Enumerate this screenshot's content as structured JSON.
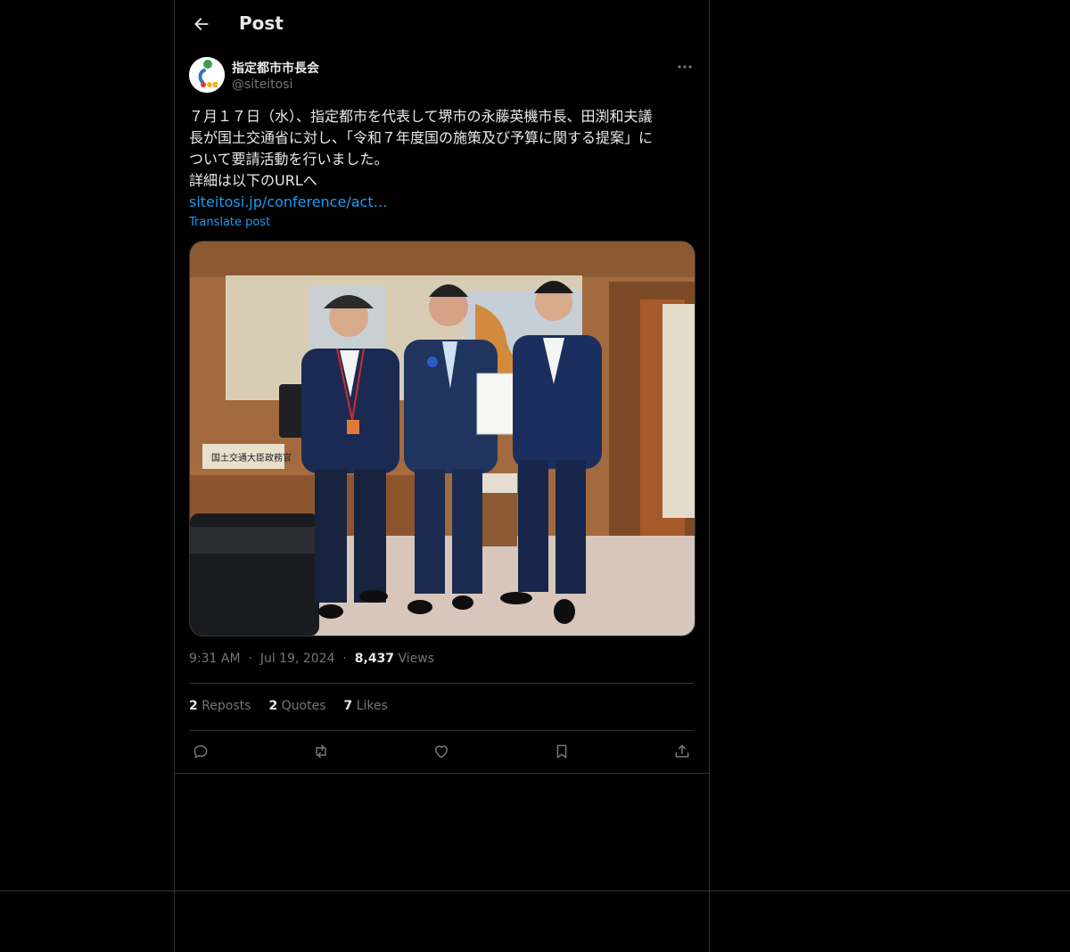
{
  "header": {
    "title": "Post",
    "back_icon": "arrow-left-icon"
  },
  "author": {
    "name": "指定都市市長会",
    "handle": "@siteitosi"
  },
  "post": {
    "lines": [
      "７月１７日（水）、指定都市を代表して堺市の永藤英機市長、田渕和夫議",
      "長が国土交通省に対し、「令和７年度国の施策及び予算に関する提案」に",
      "ついて要請活動を行いました。",
      "詳細は以下のURLへ"
    ],
    "link_text": "siteitosi.jp/conference/act…",
    "translate_label": "Translate post",
    "media_sign_text": "国土交通大臣政務官"
  },
  "meta": {
    "time": "9:31 AM",
    "date": "Jul 19, 2024",
    "views_count": "8,437",
    "views_label": "Views"
  },
  "stats": {
    "reposts_count": "2",
    "reposts_label": "Reposts",
    "quotes_count": "2",
    "quotes_label": "Quotes",
    "likes_count": "7",
    "likes_label": "Likes"
  },
  "actions": [
    "reply-icon",
    "repost-icon",
    "like-icon",
    "bookmark-icon",
    "share-icon"
  ],
  "colors": {
    "link": "#1d9bf0",
    "muted": "#71767b",
    "border": "#2f3336",
    "text": "#e7e9ea"
  }
}
